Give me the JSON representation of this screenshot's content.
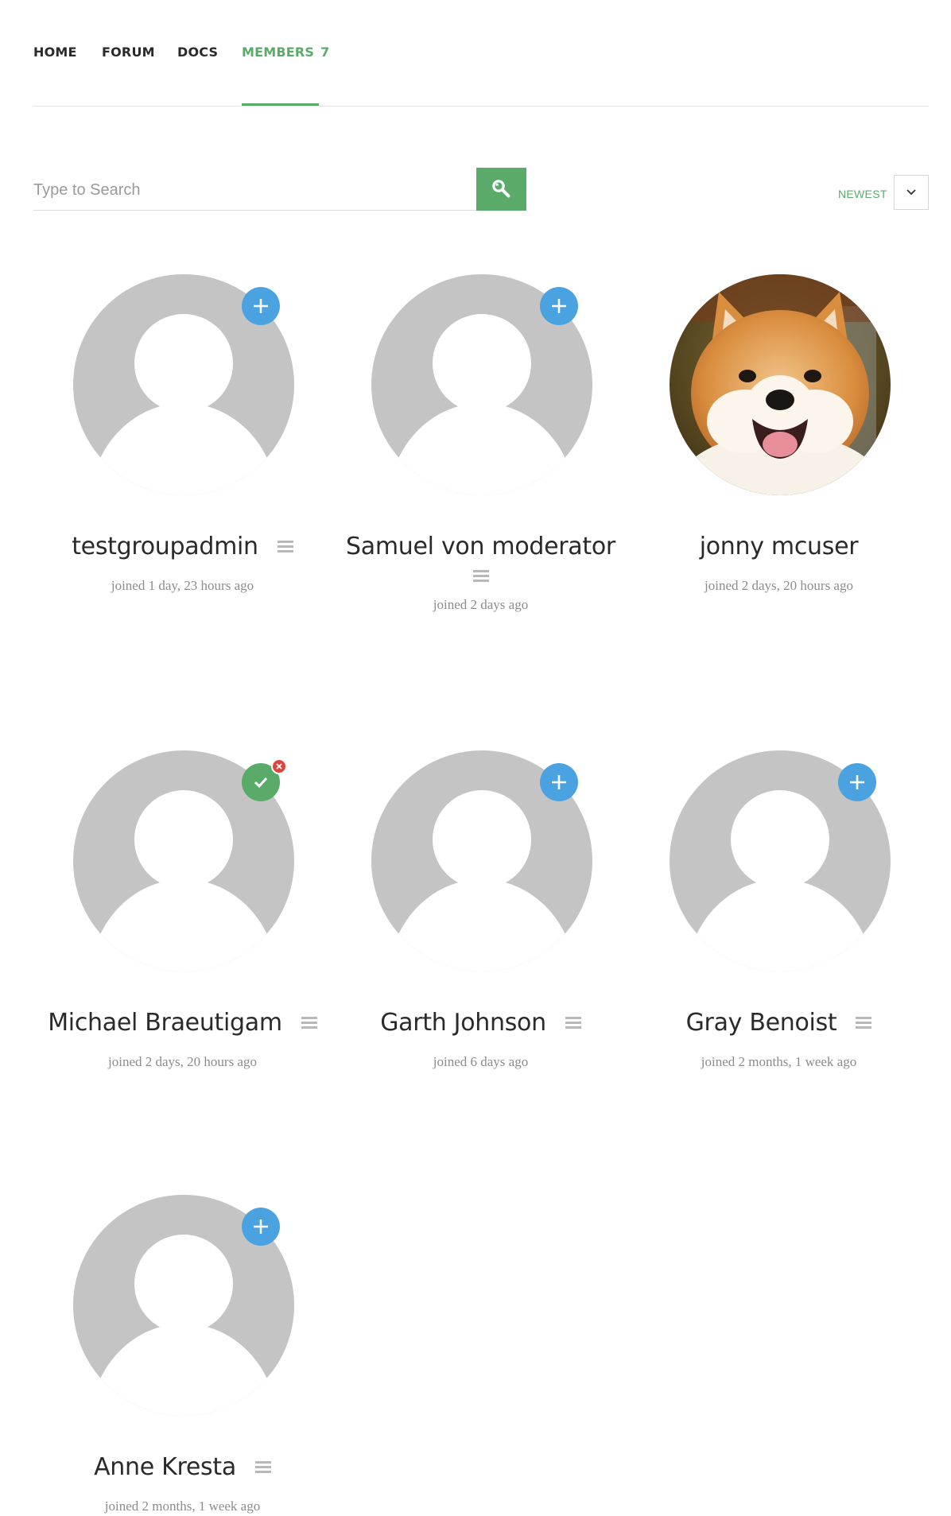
{
  "nav": {
    "items": [
      {
        "label": "HOME"
      },
      {
        "label": "FORUM"
      },
      {
        "label": "DOCS"
      },
      {
        "label": "MEMBERS",
        "count": "7",
        "active": true
      }
    ]
  },
  "search": {
    "placeholder": "Type to Search",
    "button_icon": "search-icon"
  },
  "sort": {
    "label": "NEWEST",
    "icon": "chevron-down-icon"
  },
  "colors": {
    "accent_green": "#5aab6a",
    "add_blue": "#4aa3e0",
    "remove_red": "#e0443f"
  },
  "members": [
    {
      "name": "testgroupadmin",
      "joined": "joined 1 day, 23 hours ago",
      "avatar": "default-avatar",
      "action": "add-friend-icon"
    },
    {
      "name": "Samuel von moderator",
      "joined": "joined 2 days ago",
      "avatar": "default-avatar",
      "action": "add-friend-icon"
    },
    {
      "name": "jonny mcuser",
      "joined": "joined 2 days, 20 hours ago",
      "avatar": "shiba-inu-dog-photo",
      "action": ""
    },
    {
      "name": "Michael Braeutigam",
      "joined": "joined 2 days, 20 hours ago",
      "avatar": "default-avatar",
      "action": "friend-check-icon"
    },
    {
      "name": "Garth Johnson",
      "joined": "joined 6 days ago",
      "avatar": "default-avatar",
      "action": "add-friend-icon"
    },
    {
      "name": "Gray Benoist",
      "joined": "joined 2 months, 1 week ago",
      "avatar": "default-avatar",
      "action": "add-friend-icon"
    },
    {
      "name": "Anne Kresta",
      "joined": "joined 2 months, 1 week ago",
      "avatar": "default-avatar",
      "action": "add-friend-icon"
    }
  ]
}
